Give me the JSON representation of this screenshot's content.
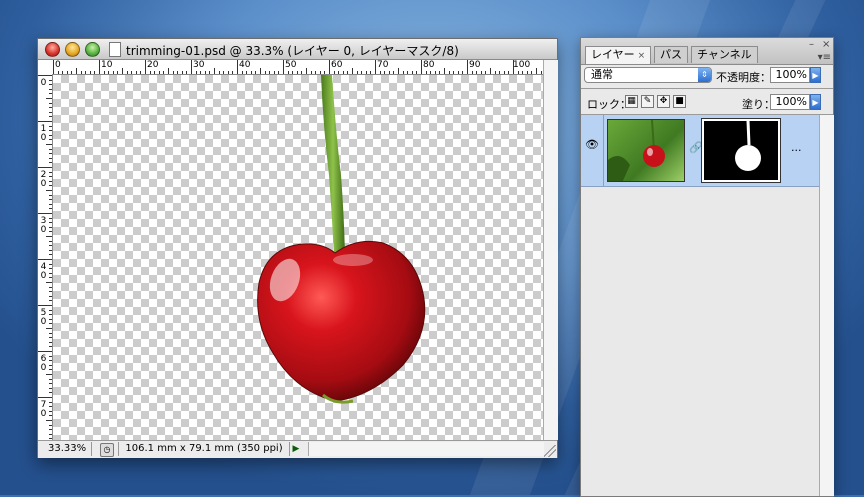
{
  "document": {
    "title": "trimming-01.psd @ 33.3% (レイヤー 0, レイヤーマスク/8)",
    "ruler_top_labels": [
      "0",
      "10",
      "20",
      "30",
      "40",
      "50",
      "60",
      "70",
      "80",
      "90",
      "100"
    ],
    "ruler_left_labels": [
      "0",
      "1 0",
      "2 0",
      "3 0",
      "4 0",
      "5 0",
      "6 0",
      "7 0"
    ],
    "zoom": "33.33%",
    "doc_size": "106.1 mm x 79.1 mm (350 ppi)",
    "canvas_content": "cherry-on-transparent"
  },
  "layers_palette": {
    "tabs": [
      {
        "label": "レイヤー",
        "active": true,
        "closable": true
      },
      {
        "label": "パス",
        "active": false,
        "closable": false
      },
      {
        "label": "チャンネル",
        "active": false,
        "closable": false
      }
    ],
    "blend_mode": "通常",
    "opacity_label": "不透明度：",
    "opacity_value": "100%",
    "lock_label": "ロック：",
    "fill_label": "塗り：",
    "fill_value": "100%",
    "layers": [
      {
        "name": "...",
        "visible": true,
        "has_mask": true
      }
    ]
  },
  "colors": {
    "selection_highlight": "#b7d2f3",
    "cherry_red": "#c8101a",
    "stem_green": "#6b9a2a"
  },
  "icons": {
    "close": "close-icon",
    "minimize": "minimize-icon",
    "zoom": "zoom-icon",
    "eye": "eye-icon",
    "chain": "link-icon"
  }
}
